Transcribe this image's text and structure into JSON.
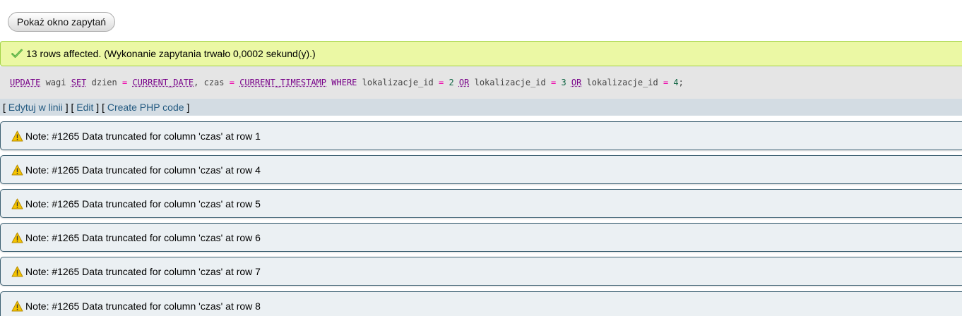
{
  "toolbar": {
    "show_query_label": "Pokaż okno zapytań"
  },
  "result": {
    "message": "13 rows affected. (Wykonanie zapytania trwało 0,0002 sekund(y).)",
    "icon": "success-check-icon",
    "color": "#ebf8a4"
  },
  "sql": {
    "tokens": [
      {
        "text": "UPDATE",
        "type": "kw"
      },
      {
        "text": " wagi ",
        "type": "ident"
      },
      {
        "text": "SET",
        "type": "kw"
      },
      {
        "text": " dzien ",
        "type": "ident"
      },
      {
        "text": "=",
        "type": "op"
      },
      {
        "text": " ",
        "type": "ident"
      },
      {
        "text": "CURRENT_DATE",
        "type": "kw"
      },
      {
        "text": ", czas ",
        "type": "ident"
      },
      {
        "text": "=",
        "type": "op"
      },
      {
        "text": " ",
        "type": "ident"
      },
      {
        "text": "CURRENT_TIMESTAMP",
        "type": "kw"
      },
      {
        "text": " ",
        "type": "ident"
      },
      {
        "text": "WHERE",
        "type": "kw-plain"
      },
      {
        "text": " lokalizacje_id ",
        "type": "ident"
      },
      {
        "text": "=",
        "type": "op"
      },
      {
        "text": " ",
        "type": "ident"
      },
      {
        "text": "2",
        "type": "num"
      },
      {
        "text": " ",
        "type": "ident"
      },
      {
        "text": "OR",
        "type": "kw"
      },
      {
        "text": " lokalizacje_id ",
        "type": "ident"
      },
      {
        "text": "=",
        "type": "op"
      },
      {
        "text": " ",
        "type": "ident"
      },
      {
        "text": "3",
        "type": "num"
      },
      {
        "text": " ",
        "type": "ident"
      },
      {
        "text": "OR",
        "type": "kw"
      },
      {
        "text": " lokalizacje_id ",
        "type": "ident"
      },
      {
        "text": "=",
        "type": "op"
      },
      {
        "text": " ",
        "type": "ident"
      },
      {
        "text": "4",
        "type": "num"
      },
      {
        "text": ";",
        "type": "ident"
      }
    ]
  },
  "tools": {
    "bracket_open": "[",
    "bracket_close": "]",
    "edit_inline": "Edytuj w linii",
    "edit": "Edit",
    "create_php": "Create PHP code"
  },
  "notes": [
    {
      "text": "Note: #1265 Data truncated for column 'czas' at row 1"
    },
    {
      "text": "Note: #1265 Data truncated for column 'czas' at row 4"
    },
    {
      "text": "Note: #1265 Data truncated for column 'czas' at row 5"
    },
    {
      "text": "Note: #1265 Data truncated for column 'czas' at row 6"
    },
    {
      "text": "Note: #1265 Data truncated for column 'czas' at row 7"
    },
    {
      "text": "Note: #1265 Data truncated for column 'czas' at row 8"
    }
  ],
  "colors": {
    "success_bg": "#ebf8a4",
    "sql_bg": "#e5e5e5",
    "tools_bg": "#d3dce3",
    "note_bg": "#ebf0f3",
    "link": "#235a81",
    "keyword": "#770088",
    "operator": "#ee00aa"
  }
}
